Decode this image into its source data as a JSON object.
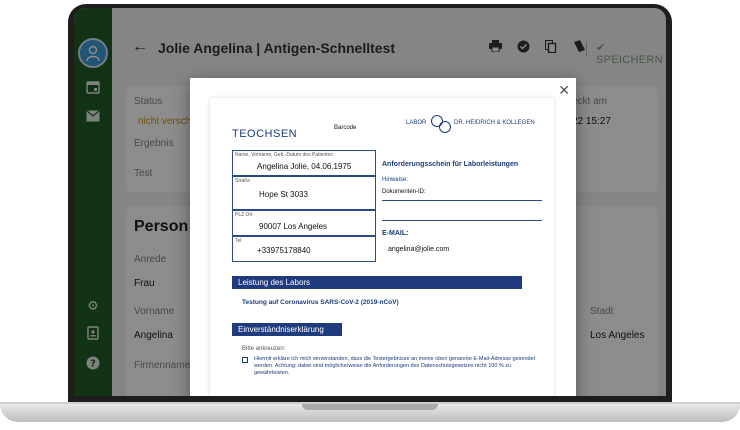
{
  "header": {
    "title": "Jolie Angelina | Antigen-Schnelltest",
    "save_label": "SPEICHERN"
  },
  "status_card": {
    "status_label": "Status",
    "status_value": "nicht verschi",
    "result_label": "Ergebnis",
    "test_label": "Test",
    "checked_label": "eckt am",
    "checked_value": "22 15:27"
  },
  "person_card": {
    "title": "Person",
    "salutation_label": "Anrede",
    "salutation_value": "Frau",
    "firstname_label": "Vorname",
    "firstname_value": "Angelina",
    "company_label": "Firmenname",
    "city_label": "Stadt",
    "city_value": "Los Angeles"
  },
  "document": {
    "brand": "TEOCHSEN",
    "barcode_label": "Barcode",
    "lab_prefix": "LABOR",
    "lab_name": "DR. HEIDRICH & KOLLEGEN",
    "name_field_label": "Name, Vorname, Geb.-Datum des Patienten",
    "name_field_value": "Angelina Jolie, 04.06.1975",
    "street_label": "Straße",
    "street_value": "Hope St 3033",
    "zip_label": "PLZ Ort",
    "zip_value": "90007 Los Angeles",
    "tel_label": "Tel",
    "tel_value": "+33975178840",
    "request_title": "Anforderungsschein für Laborleistungen",
    "hint_label": "Hinweise:",
    "doc_id_label": "Dokumenten-ID:",
    "email_label": "E-MAIL:",
    "email_value": "angelina@jolie.com",
    "service_bar": "Leistung des Labors",
    "service_text": "Testung auf Coronavirus SARS-CoV-2 (2019-nCoV)",
    "consent_bar": "Einverständniserklärung",
    "consent_hint": "Bitte ankreuzen:",
    "consent_text": "Hiermit erkläre ich mich einverstanden, dass die Testergebnisse an meine oben genannte E-Mail-Adresse gesendet werden. Achtung: dabei sind möglicherweise die Anforderungen des Datenschutzgesetzes nicht 100 % zu gewährleisten."
  },
  "icons": {
    "sidebar": [
      "avatar-doctor-icon",
      "calendar-icon",
      "mail-icon",
      "settings-icon",
      "badge-icon",
      "help-icon"
    ],
    "toolbar": [
      "print-icon",
      "verified-icon",
      "copy-icon",
      "bookmark-icon",
      "check-double-icon"
    ]
  },
  "colors": {
    "sidebar": "#1f5c27",
    "status_warning": "#c7961b",
    "doc_blue": "#1f3a7d"
  }
}
